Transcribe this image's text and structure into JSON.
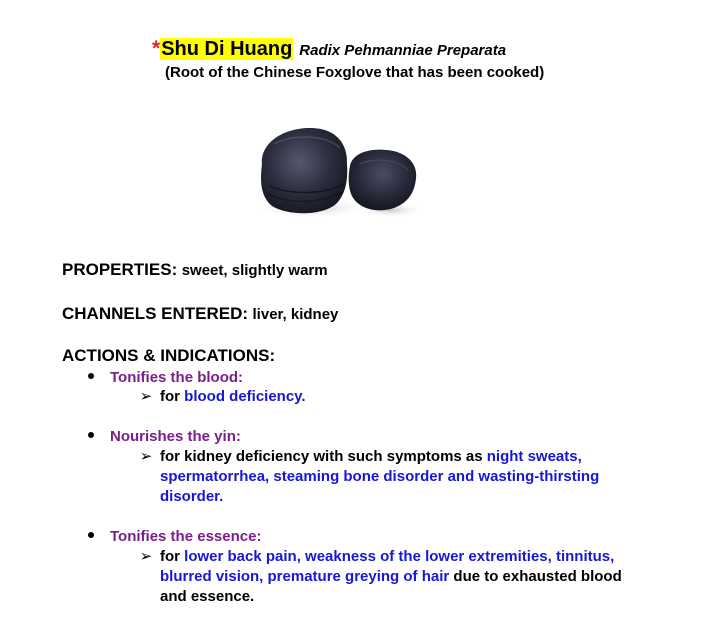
{
  "header": {
    "asterisk": "*",
    "title": "Shu Di Huang",
    "latin_name": "Radix Pehmanniae Preparata",
    "subtitle": "(Root of the Chinese Foxglove that has been cooked)"
  },
  "properties": {
    "label": "PROPERTIES:",
    "value": "sweet, slightly warm"
  },
  "channels": {
    "label": "CHANNELS ENTERED:",
    "value": "liver, kidney"
  },
  "actions": {
    "heading": "ACTIONS & INDICATIONS:",
    "items": [
      {
        "title": "Tonifies the blood:",
        "detail_parts": [
          "for ",
          "blood deficiency."
        ]
      },
      {
        "title": "Nourishes the yin:",
        "detail_parts": [
          "for kidney deficiency with such symptoms as ",
          "night sweats, spermatorrhea, steaming bone disorder and wasting-thirsting disorder."
        ]
      },
      {
        "title": "Tonifies the essence:",
        "detail_parts": [
          "for ",
          "lower back pain, weakness of the lower extremities, tinnitus, blurred vision, premature greying of hair",
          " due to exhausted blood and essence."
        ]
      }
    ]
  },
  "colors": {
    "highlight": "#ffff00",
    "asterisk": "#e8202a",
    "purple_heading": "#7a1f8c",
    "blue_term": "#1717d6"
  },
  "icons": {
    "bullet": "bullet-dot-icon",
    "arrow": "arrow-bullet-icon"
  }
}
